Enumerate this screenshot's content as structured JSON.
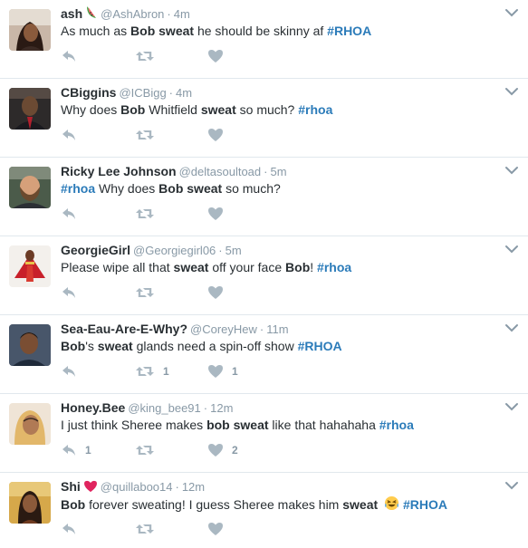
{
  "colors": {
    "link": "#2b7bb9",
    "meta": "#8899a6",
    "icon": "#aab8c2",
    "heart_emoji": "#e0245e"
  },
  "tweets": [
    {
      "fullname": "ash",
      "emoji": "watermelon-icon",
      "handle": "@AshAbron",
      "time": "4m",
      "text_parts": [
        {
          "t": "As much as ",
          "s": "plain"
        },
        {
          "t": "Bob",
          "s": "bold"
        },
        {
          "t": " ",
          "s": "plain"
        },
        {
          "t": "sweat",
          "s": "bold"
        },
        {
          "t": " he should be skinny af ",
          "s": "plain"
        },
        {
          "t": "#RHOA",
          "s": "hashtag"
        }
      ],
      "reply_count": "",
      "retweet_count": "",
      "like_count": ""
    },
    {
      "fullname": "CBiggins",
      "emoji": "",
      "handle": "@ICBigg",
      "time": "4m",
      "text_parts": [
        {
          "t": "Why does ",
          "s": "plain"
        },
        {
          "t": "Bob",
          "s": "bold"
        },
        {
          "t": " Whitfield ",
          "s": "plain"
        },
        {
          "t": "sweat",
          "s": "bold"
        },
        {
          "t": " so much? ",
          "s": "plain"
        },
        {
          "t": "#rhoa",
          "s": "hashtag"
        }
      ],
      "reply_count": "",
      "retweet_count": "",
      "like_count": ""
    },
    {
      "fullname": "Ricky Lee Johnson",
      "emoji": "",
      "handle": "@deltasoultoad",
      "time": "5m",
      "text_parts": [
        {
          "t": "#rhoa",
          "s": "hashtag"
        },
        {
          "t": " Why does ",
          "s": "plain"
        },
        {
          "t": "Bob",
          "s": "bold"
        },
        {
          "t": " ",
          "s": "plain"
        },
        {
          "t": "sweat",
          "s": "bold"
        },
        {
          "t": " so much?",
          "s": "plain"
        }
      ],
      "reply_count": "",
      "retweet_count": "",
      "like_count": ""
    },
    {
      "fullname": "GeorgieGirl",
      "emoji": "",
      "handle": "@Georgiegirl06",
      "time": "5m",
      "text_parts": [
        {
          "t": "Please wipe all that ",
          "s": "plain"
        },
        {
          "t": "sweat",
          "s": "bold"
        },
        {
          "t": " off your face ",
          "s": "plain"
        },
        {
          "t": "Bob",
          "s": "bold"
        },
        {
          "t": "! ",
          "s": "plain"
        },
        {
          "t": "#rhoa",
          "s": "hashtag"
        }
      ],
      "reply_count": "",
      "retweet_count": "",
      "like_count": ""
    },
    {
      "fullname": "Sea-Eau-Are-E-Why?",
      "emoji": "",
      "handle": "@CoreyHew",
      "time": "11m",
      "text_parts": [
        {
          "t": "Bob",
          "s": "bold"
        },
        {
          "t": "'s ",
          "s": "plain"
        },
        {
          "t": "sweat",
          "s": "bold"
        },
        {
          "t": " glands need a spin-off show ",
          "s": "plain"
        },
        {
          "t": "#RHOA",
          "s": "hashtag"
        }
      ],
      "reply_count": "",
      "retweet_count": "1",
      "like_count": "1"
    },
    {
      "fullname": "Honey.Bee",
      "emoji": "",
      "handle": "@king_bee91",
      "time": "12m",
      "text_parts": [
        {
          "t": "I just think Sheree makes ",
          "s": "plain"
        },
        {
          "t": "bob",
          "s": "bold"
        },
        {
          "t": " ",
          "s": "plain"
        },
        {
          "t": "sweat",
          "s": "bold"
        },
        {
          "t": " like that hahahaha ",
          "s": "plain"
        },
        {
          "t": "#rhoa",
          "s": "hashtag"
        }
      ],
      "reply_count": "1",
      "retweet_count": "",
      "like_count": "2"
    },
    {
      "fullname": "Shi",
      "emoji": "red-heart-icon",
      "handle": "@quillaboo14",
      "time": "12m",
      "text_parts": [
        {
          "t": "Bob",
          "s": "bold"
        },
        {
          "t": " forever sweating! I guess Sheree makes him ",
          "s": "plain"
        },
        {
          "t": "sweat",
          "s": "bold"
        },
        {
          "t": " ",
          "s": "plain"
        },
        {
          "t": "laughing-tears-emoji",
          "s": "emoji"
        },
        {
          "t": " ",
          "s": "plain"
        },
        {
          "t": "#RHOA",
          "s": "hashtag"
        }
      ],
      "reply_count": "",
      "retweet_count": "",
      "like_count": ""
    }
  ]
}
